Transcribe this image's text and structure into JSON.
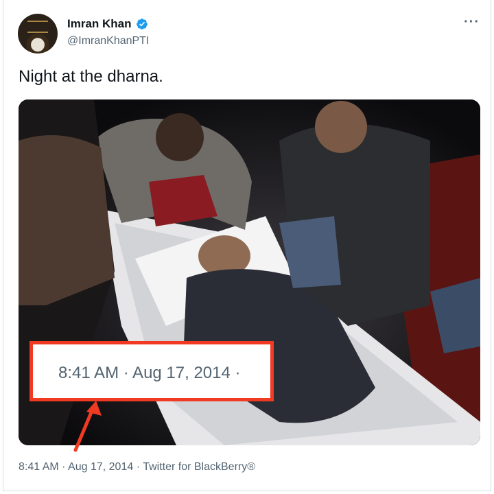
{
  "author": {
    "name": "Imran Khan",
    "handle": "@ImranKhanPTI",
    "verified": true
  },
  "menu": {
    "more_label": "···"
  },
  "tweet": {
    "text": "Night at the dharna."
  },
  "callout": {
    "text": "8:41 AM · Aug 17, 2014 ·",
    "border_color": "#f03a22"
  },
  "meta": {
    "time": "8:41 AM",
    "separator": "·",
    "date": "Aug 17, 2014",
    "source": "Twitter for BlackBerry®"
  },
  "colors": {
    "verified_blue": "#1d9bf0",
    "secondary_text": "#536471"
  },
  "icons": {
    "verified": "verified-badge-icon",
    "more": "more-options-icon"
  }
}
